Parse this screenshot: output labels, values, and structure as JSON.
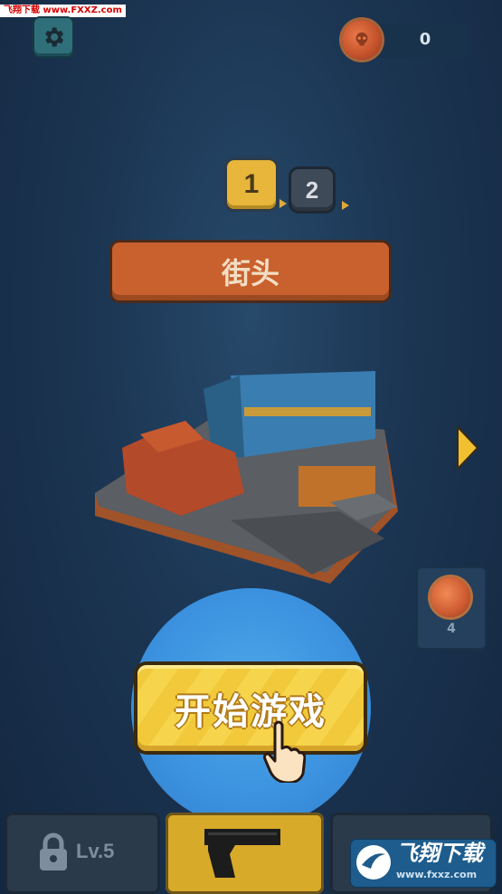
{
  "watermark": "飞翔下载 www.FXXZ.com",
  "header": {
    "coins": "0"
  },
  "levels": [
    {
      "label": "1",
      "selected": true
    },
    {
      "label": "2",
      "selected": false
    }
  ],
  "stage": {
    "name": "街头"
  },
  "reward": {
    "count": "4"
  },
  "start_button": {
    "label": "开始游戏"
  },
  "bottom_bar": {
    "left_slot_label": "Lv.5",
    "middle_slot_icon": "pistol-icon",
    "right_slot_icon": "lock-icon"
  },
  "logo": {
    "main": "飞翔下载",
    "sub": "www.fxxz.com"
  },
  "colors": {
    "background": "#1b3552",
    "stage_banner": "#c8612e",
    "start_button": "#f6d54c",
    "spotlight": "#3b91de",
    "level_selected": "#e7b63a"
  }
}
